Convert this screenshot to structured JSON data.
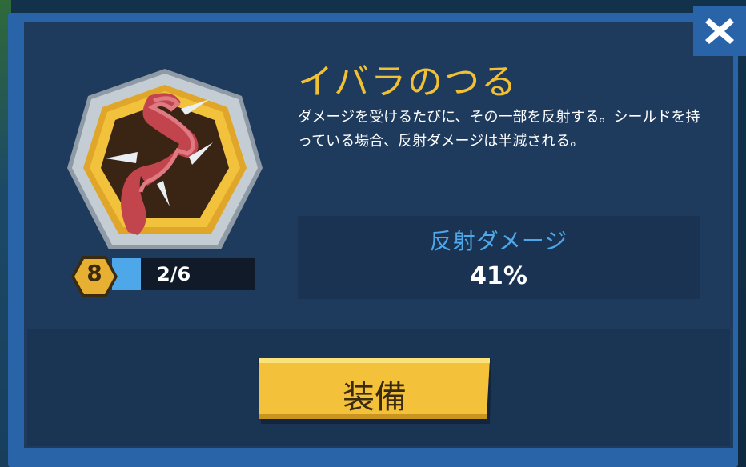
{
  "item": {
    "title": "イバラのつる",
    "description": "ダメージを受けるたびに、その一部を反射する。シールドを持っている場合、反射ダメージは半減される。",
    "icon": "thorn-vine-icon"
  },
  "level": {
    "value": "8",
    "progress_text": "2/6",
    "progress_fraction": 0.2
  },
  "stat": {
    "label": "反射ダメージ",
    "value": "41%"
  },
  "buttons": {
    "equip_label": "装備",
    "close_icon": "close-icon"
  },
  "colors": {
    "title": "#f2c033",
    "stat_label": "#4ea7e8",
    "frame": "#2a64a8",
    "panel": "#1e3b5e",
    "button": "#f4c23a"
  }
}
